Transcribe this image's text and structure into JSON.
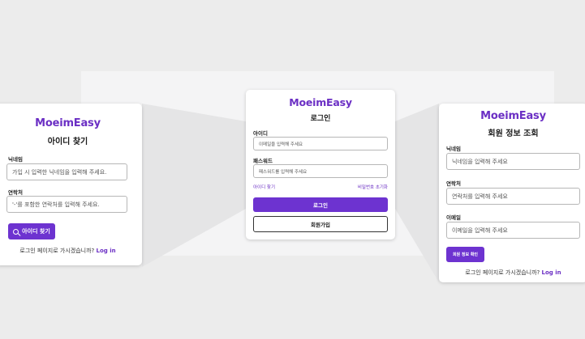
{
  "brand": "MoeimEasy",
  "find_id_card": {
    "title": "아이디 찾기",
    "nickname_label": "닉네임",
    "nickname_placeholder": "가입 시 입력한 닉네임을 입력해 주세요.",
    "phone_label": "연락처",
    "phone_placeholder": "'-'를 포함한 연락처를 입력해 주세요.",
    "submit_label": "아이디 찾기",
    "footer_text": "로그인 페이지로 가시겠습니까?",
    "footer_link": "Log in"
  },
  "login_card": {
    "title": "로그인",
    "id_label": "아이디",
    "id_placeholder": "이메일을 입력해 주세요",
    "password_label": "패스워드",
    "password_placeholder": "패스워드를 입력해 주세요",
    "find_id_link": "아이디 찾기",
    "reset_password_link": "비밀번호 초기화",
    "login_button": "로그인",
    "signup_button": "회원가입"
  },
  "member_info_card": {
    "title": "회원 정보 조회",
    "nickname_label": "닉네임",
    "nickname_placeholder": "닉네임을 입력해 주세요",
    "phone_label": "연락처",
    "phone_placeholder": "연락처를 입력해 주세요",
    "email_label": "이메일",
    "email_placeholder": "이메일을 입력해 주세요",
    "confirm_button": "회원 정보 확인",
    "footer_text": "로그인 페이지로 가시겠습니까?",
    "footer_link": "Log in"
  },
  "colors": {
    "accent": "#6d33d0",
    "brand_text": "#6b2fc4",
    "background": "#ececec"
  }
}
